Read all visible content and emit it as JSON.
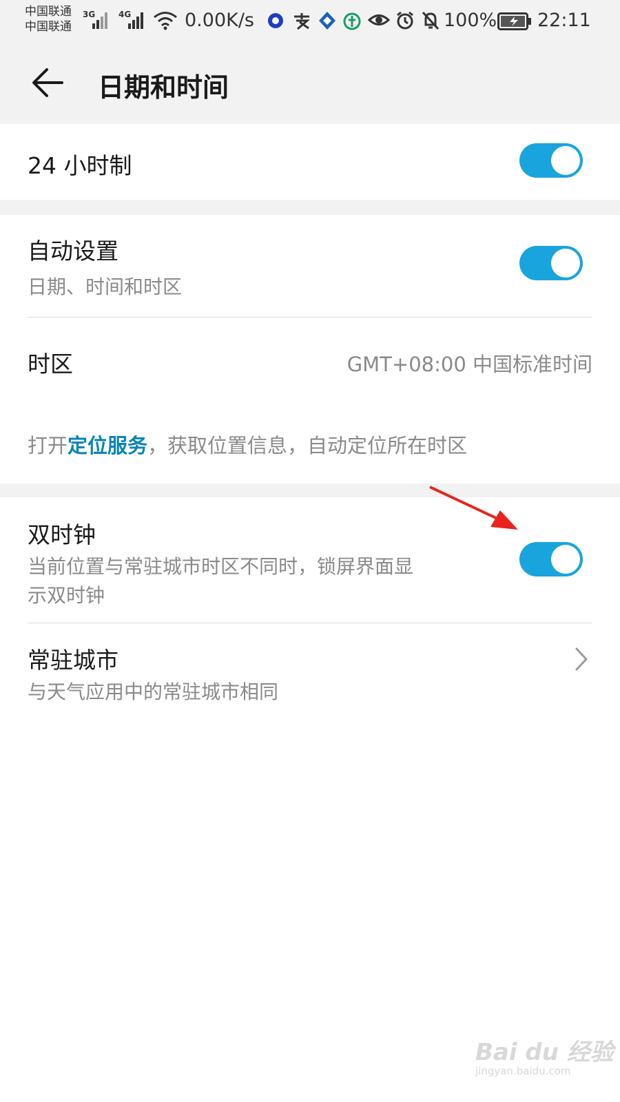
{
  "status_bar": {
    "carrier_1": "中国联通",
    "carrier_2": "中国联通",
    "net_1": "3G",
    "net_2": "4G",
    "speed": "0.00K/s",
    "battery_pct": "100%",
    "time": "22:11",
    "icons": [
      "signal-icon",
      "signal-icon",
      "wifi-icon",
      "app-icon",
      "alipay-icon",
      "bank-icon",
      "wallet-icon",
      "eye-icon",
      "alarm-icon",
      "mute-icon",
      "battery-icon"
    ]
  },
  "header": {
    "title": "日期和时间"
  },
  "settings": {
    "hour24": {
      "label": "24 小时制",
      "enabled": true
    },
    "auto": {
      "label": "自动设置",
      "sub": "日期、时间和时区",
      "enabled": true
    },
    "timezone": {
      "label": "时区",
      "value": "GMT+08:00 中国标准时间"
    },
    "hint": {
      "prefix": "打开",
      "link": "定位服务",
      "suffix": "，获取位置信息，自动定位所在时区"
    },
    "dual_clock": {
      "label": "双时钟",
      "sub_line1": "当前位置与常驻城市时区不同时，锁屏界面显",
      "sub_line2": "示双时钟",
      "enabled": true
    },
    "home_city": {
      "label": "常驻城市",
      "sub": "与天气应用中的常驻城市相同"
    }
  },
  "colors": {
    "accent": "#1aa4dd",
    "link": "#0a84b8",
    "annotation_arrow": "#e8241c"
  },
  "watermark": {
    "logo": "Bai du 经验",
    "url": "jingyan.baidu.com"
  }
}
